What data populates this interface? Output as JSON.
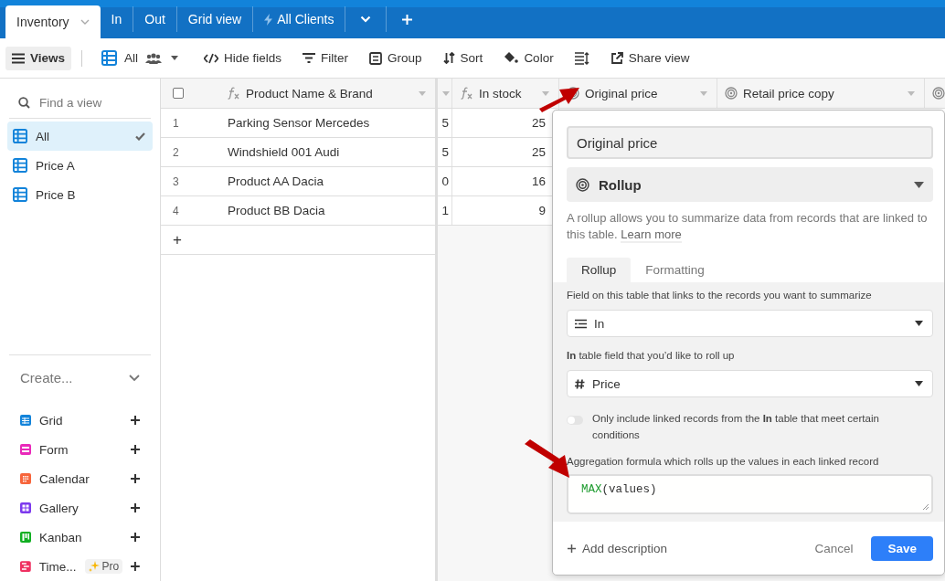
{
  "tabs": [
    {
      "label": "Inventory",
      "selected": true,
      "kind": "table"
    },
    {
      "label": "In",
      "selected": false,
      "kind": "table"
    },
    {
      "label": "Out",
      "selected": false,
      "kind": "table"
    },
    {
      "label": "Grid view",
      "selected": false,
      "kind": "table"
    },
    {
      "label": "All Clients",
      "selected": false,
      "kind": "automation"
    }
  ],
  "toolbar": [
    {
      "kind": "views",
      "label": "Views"
    },
    {
      "kind": "view-switcher",
      "label": "All"
    },
    {
      "kind": "hide",
      "label": "Hide fields"
    },
    {
      "kind": "filter",
      "label": "Filter"
    },
    {
      "kind": "group",
      "label": "Group"
    },
    {
      "kind": "sort",
      "label": "Sort"
    },
    {
      "kind": "color",
      "label": "Color"
    },
    {
      "kind": "row-height"
    },
    {
      "kind": "share",
      "label": "Share view"
    }
  ],
  "sidebar": {
    "search": {
      "placeholder": "Find a view"
    },
    "views": [
      {
        "label": "All",
        "selected": true
      },
      {
        "label": "Price A",
        "selected": false
      },
      {
        "label": "Price B",
        "selected": false
      }
    ],
    "create": {
      "title": "Create...",
      "items": [
        {
          "label": "Grid",
          "kind": "grid",
          "color": "#1283da"
        },
        {
          "label": "Form",
          "kind": "form",
          "color": "#e929ba"
        },
        {
          "label": "Calendar",
          "kind": "calendar",
          "color": "#f7653b"
        },
        {
          "label": "Gallery",
          "kind": "gallery",
          "color": "#7c39ed"
        },
        {
          "label": "Kanban",
          "kind": "kanban",
          "color": "#11af22"
        },
        {
          "label": "Time...",
          "kind": "timeline",
          "color": "#ef3061",
          "badge": "Pro"
        }
      ]
    }
  },
  "table": {
    "select_all_checked": false,
    "columns": [
      {
        "name": "Product Name & Brand",
        "kind": "formula"
      },
      {
        "kind": "partial"
      },
      {
        "name": "In stock",
        "kind": "formula"
      },
      {
        "name": "Original price",
        "kind": "rollup"
      },
      {
        "name": "Retail price copy",
        "kind": "rollup"
      },
      {
        "kind": "rollup"
      }
    ],
    "rows": [
      {
        "number": "1",
        "cells": [
          "Parking Sensor Mercedes",
          "5",
          "25"
        ]
      },
      {
        "number": "2",
        "cells": [
          "Windshield 001 Audi",
          "5",
          "25"
        ]
      },
      {
        "number": "3",
        "cells": [
          "Product AA Dacia",
          "0",
          "16"
        ]
      },
      {
        "number": "4",
        "cells": [
          "Product BB Dacia",
          "1",
          "9"
        ]
      }
    ],
    "add_row": "+"
  },
  "field_editor": {
    "name": "Original price",
    "type": "Rollup",
    "description": "A rollup allows you to summarize data from records that are linked to this table.",
    "learn_more": "Learn more",
    "tabs": [
      {
        "label": "Rollup",
        "selected": true
      },
      {
        "label": "Formatting",
        "selected": false
      }
    ],
    "link_label": "Field on this table that links to the records you want to summarize",
    "link_value": "In",
    "rollup_label": "**In** table field that you’d like to roll up",
    "rollup_value": "Price",
    "filter": {
      "label": "Only include linked records from the **In** table that meet certain conditions",
      "on": false
    },
    "formula_label": "Aggregation formula which rolls up the values in each linked record",
    "formula": {
      "function": "MAX",
      "rest": "(values)"
    },
    "add_description": "Add description",
    "cancel": "Cancel",
    "save": "Save"
  }
}
